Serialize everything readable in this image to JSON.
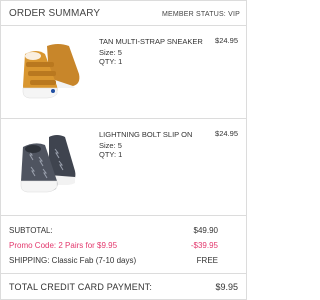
{
  "header": {
    "title": "ORDER SUMMARY",
    "member_status": "MEMBER STATUS: VIP"
  },
  "items": [
    {
      "name": "TAN MULTI-STRAP SNEAKER",
      "size": "Size: 5",
      "qty": "QTY: 1",
      "price": "$24.95",
      "image_icon": "tan-sneaker-image",
      "color": "#d9962f"
    },
    {
      "name": "LIGHTNING BOLT SLIP ON",
      "size": "Size: 5",
      "qty": "QTY: 1",
      "price": "$24.95",
      "image_icon": "slip-on-image",
      "color": "#4f5460"
    }
  ],
  "totals": {
    "subtotal_label": "SUBTOTAL:",
    "subtotal_value": "$49.90",
    "promo_label": "Promo Code: 2 Pairs for $9.95",
    "promo_value": "-$39.95",
    "shipping_label": "SHIPPING: Classic Fab (7-10 days)",
    "shipping_value": "FREE",
    "total_label": "TOTAL CREDIT CARD PAYMENT:",
    "total_value": "$9.95"
  },
  "colors": {
    "promo": "#e3386d",
    "border": "#dcdcdc"
  }
}
